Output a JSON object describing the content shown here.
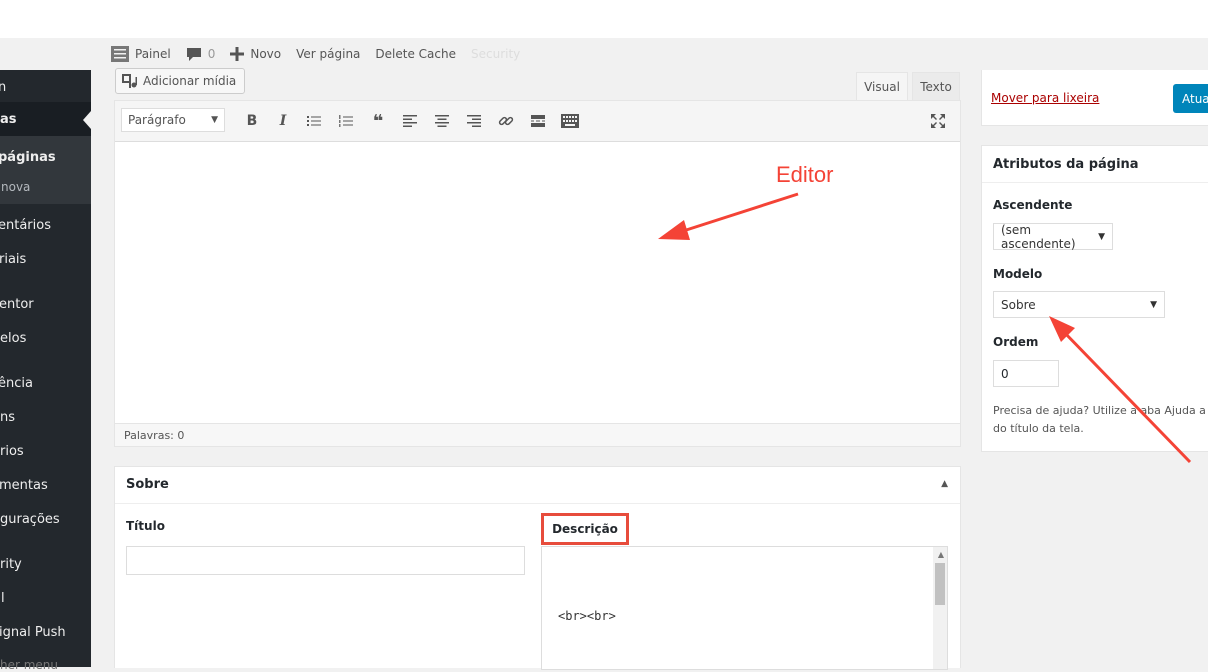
{
  "adminbar": {
    "painel": "Painel",
    "comments_count": "0",
    "novo": "Novo",
    "ver_pagina": "Ver página",
    "delete_cache": "Delete Cache",
    "security": "Security"
  },
  "sidebar": {
    "items": [
      "n",
      "as",
      "páginas",
      "nova",
      "entários",
      "riais",
      "entor",
      "elos",
      "ência",
      "ns",
      "rios",
      "mentas",
      "gurações",
      "rity",
      "l",
      "ignal Push",
      "her menu"
    ]
  },
  "editor": {
    "add_media": "Adicionar mídia",
    "tab_visual": "Visual",
    "tab_text": "Texto",
    "format": "Parágrafo",
    "word_count": "Palavras: 0"
  },
  "sobre": {
    "title": "Sobre",
    "titulo_label": "Título",
    "descricao_label": "Descrição",
    "descricao_content": "<br><br>"
  },
  "publish": {
    "trash": "Mover para lixeira",
    "update": "Atualizar"
  },
  "attributes": {
    "title": "Atributos da página",
    "ascendente_label": "Ascendente",
    "ascendente_value": "(sem ascendente)",
    "modelo_label": "Modelo",
    "modelo_value": "Sobre",
    "ordem_label": "Ordem",
    "ordem_value": "0",
    "help_line1": "Precisa de ajuda? Utilize a aba Ajuda a",
    "help_line2": "do título da tela."
  },
  "annotation": {
    "editor_label": "Editor"
  },
  "colors": {
    "annotation": "#f44336",
    "sidebar": "#23282d",
    "accent": "#0085ba"
  }
}
